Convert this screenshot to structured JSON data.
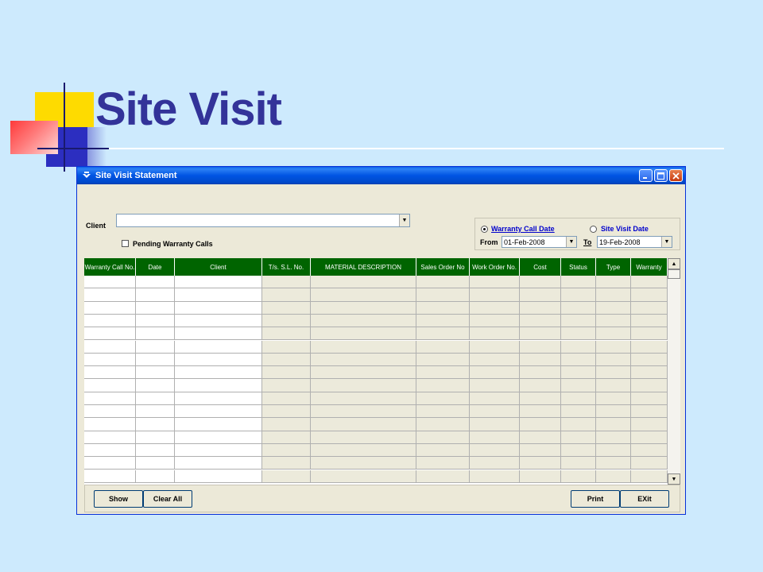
{
  "slide": {
    "title": "Site Visit"
  },
  "window": {
    "title": "Site Visit Statement"
  },
  "form": {
    "client_label": "Client",
    "client_value": "",
    "pending_label": "Pending Warranty Calls",
    "pending_checked": false,
    "radio_warranty_label": "Warranty Call Date",
    "radio_site_label": "Site Visit Date",
    "selected_radio": "warranty",
    "from_label": "From",
    "from_value": "01-Feb-2008",
    "to_label": "To",
    "to_value": "19-Feb-2008"
  },
  "grid": {
    "columns": [
      {
        "label": "Warranty Call No.",
        "shaded": false
      },
      {
        "label": "Date",
        "shaded": false
      },
      {
        "label": "Client",
        "shaded": false
      },
      {
        "label": "T/s. S.L. No.",
        "shaded": true
      },
      {
        "label": "MATERIAL DESCRIPTION",
        "shaded": true
      },
      {
        "label": "Sales Order No",
        "shaded": true
      },
      {
        "label": "Work Order No.",
        "shaded": true
      },
      {
        "label": "Cost",
        "shaded": true
      },
      {
        "label": "Status",
        "shaded": true
      },
      {
        "label": "Type",
        "shaded": true
      },
      {
        "label": "Warranty",
        "shaded": true
      }
    ],
    "row_count": 16,
    "header_color": "#006400",
    "shaded_color": "#eceadb"
  },
  "buttons": {
    "show": "Show",
    "clear_all": "Clear All",
    "print": "Print",
    "exit": "EXit"
  }
}
